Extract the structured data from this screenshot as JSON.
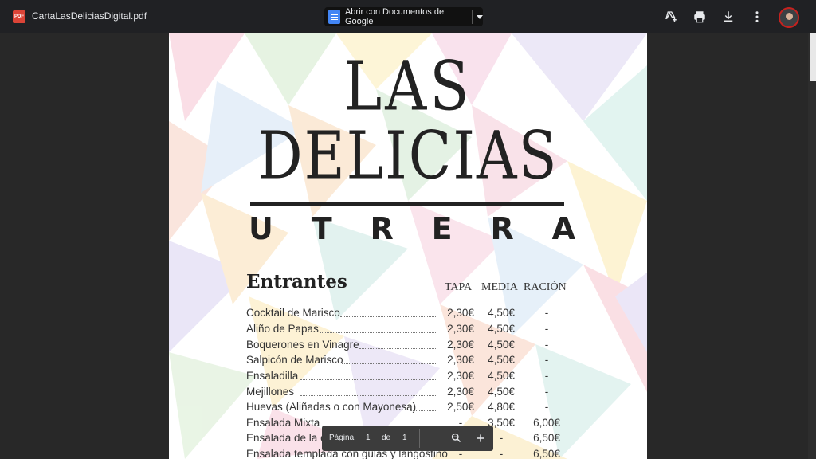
{
  "topbar": {
    "pdf_badge": "PDF",
    "file_name": "CartaLasDeliciasDigital.pdf",
    "open_with_label": "Abrir con Documentos de Google"
  },
  "document": {
    "title_line1": "LAS",
    "title_line2": "DELICIAS",
    "city_letters": [
      "U",
      "T",
      "R",
      "E",
      "R",
      "A"
    ],
    "section_title": "Entrantes",
    "columns": [
      "TAPA",
      "MEDIA",
      "RACIÓN"
    ],
    "items": [
      {
        "name": "Cocktail de Marisco",
        "tapa": "2,30€",
        "media": "4,50€",
        "racion": "-"
      },
      {
        "name": "Aliño de Papas",
        "tapa": "2,30€",
        "media": "4,50€",
        "racion": "-"
      },
      {
        "name": "Boquerones en Vinagre",
        "tapa": "2,30€",
        "media": "4,50€",
        "racion": "-"
      },
      {
        "name": "Salpicón de Marisco",
        "tapa": "2,30€",
        "media": "4,50€",
        "racion": "-"
      },
      {
        "name": "Ensaladilla",
        "tapa": "2,30€",
        "media": "4,50€",
        "racion": "-"
      },
      {
        "name": "Mejillones",
        "tapa": "2,30€",
        "media": "4,50€",
        "racion": "-"
      },
      {
        "name": "Huevas (Aliñadas o con Mayonesa)",
        "tapa": "2,50€",
        "media": "4,80€",
        "racion": "-"
      },
      {
        "name": "Ensalada Mixta",
        "tapa": "-",
        "media": "3,50€",
        "racion": "6,00€"
      },
      {
        "name": "Ensalada de la casa (bajo el tomate de pollo)",
        "tapa": "-",
        "media": "-",
        "racion": "6,50€"
      },
      {
        "name": "Ensalada templada con gulas y langostino",
        "tapa": "-",
        "media": "-",
        "racion": "6,50€"
      }
    ]
  },
  "page_toolbar": {
    "page_label": "Página",
    "current_page": "1",
    "of_label": "de",
    "total_pages": "1"
  },
  "icons": [
    "pdf-icon",
    "google-docs-icon",
    "dropdown-caret-icon",
    "add-to-drive-icon",
    "print-icon",
    "download-icon",
    "more-vert-icon",
    "zoom-icon",
    "plus-icon"
  ]
}
